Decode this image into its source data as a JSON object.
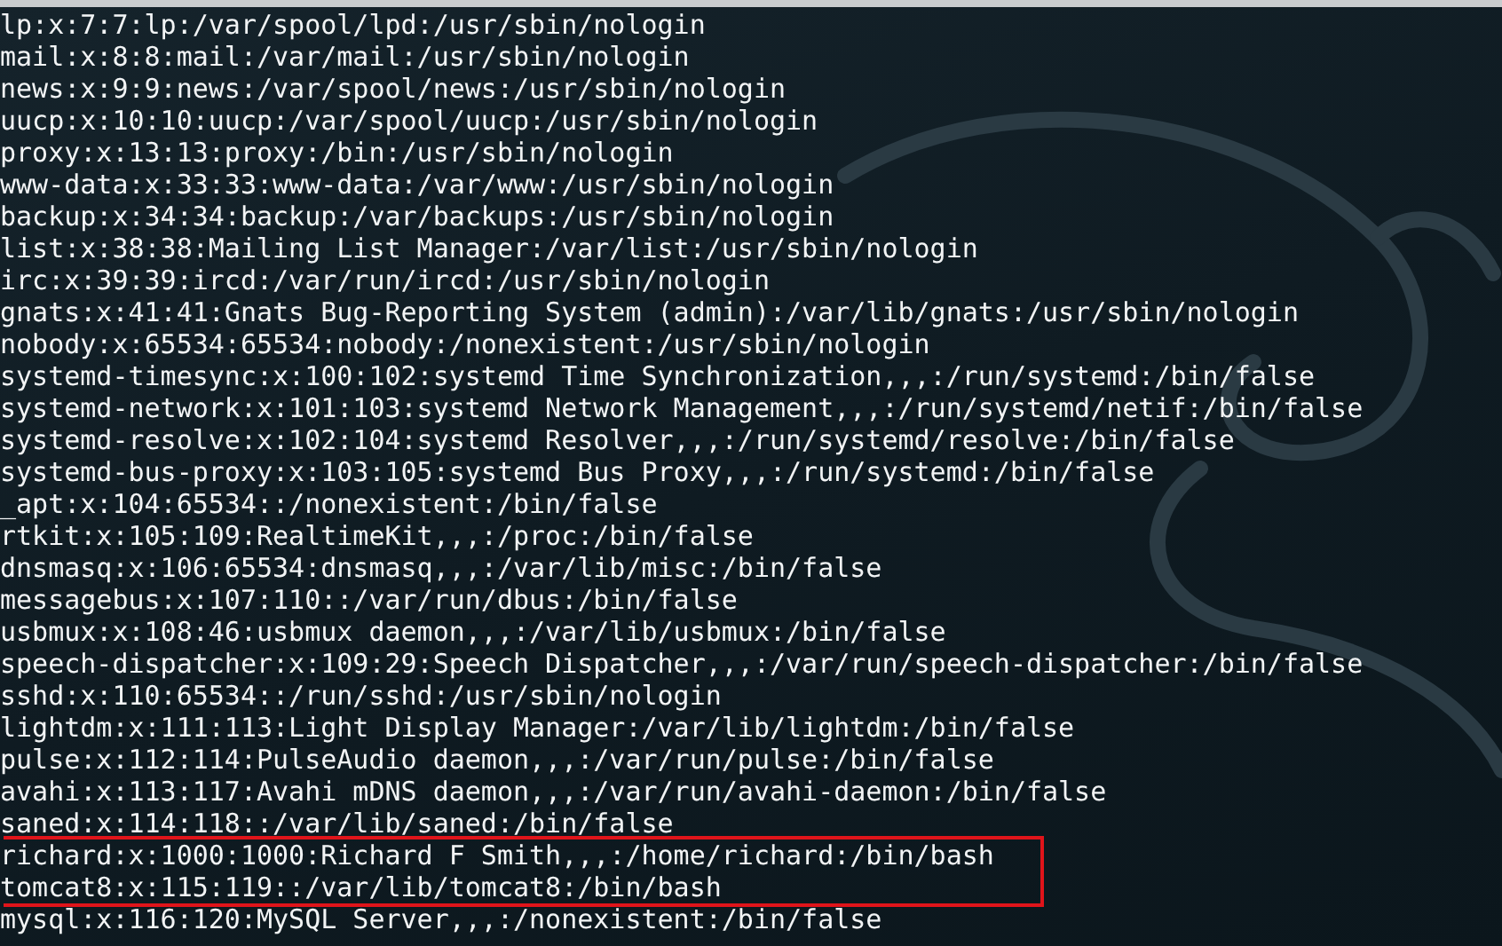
{
  "terminal": {
    "lines": [
      {
        "text": "lp:x:7:7:lp:/var/spool/lpd:/usr/sbin/nologin",
        "highlighted": false
      },
      {
        "text": "mail:x:8:8:mail:/var/mail:/usr/sbin/nologin",
        "highlighted": false
      },
      {
        "text": "news:x:9:9:news:/var/spool/news:/usr/sbin/nologin",
        "highlighted": false
      },
      {
        "text": "uucp:x:10:10:uucp:/var/spool/uucp:/usr/sbin/nologin",
        "highlighted": false
      },
      {
        "text": "proxy:x:13:13:proxy:/bin:/usr/sbin/nologin",
        "highlighted": false
      },
      {
        "text": "www-data:x:33:33:www-data:/var/www:/usr/sbin/nologin",
        "highlighted": false
      },
      {
        "text": "backup:x:34:34:backup:/var/backups:/usr/sbin/nologin",
        "highlighted": false
      },
      {
        "text": "list:x:38:38:Mailing List Manager:/var/list:/usr/sbin/nologin",
        "highlighted": false
      },
      {
        "text": "irc:x:39:39:ircd:/var/run/ircd:/usr/sbin/nologin",
        "highlighted": false
      },
      {
        "text": "gnats:x:41:41:Gnats Bug-Reporting System (admin):/var/lib/gnats:/usr/sbin/nologin",
        "highlighted": false
      },
      {
        "text": "nobody:x:65534:65534:nobody:/nonexistent:/usr/sbin/nologin",
        "highlighted": false
      },
      {
        "text": "systemd-timesync:x:100:102:systemd Time Synchronization,,,:/run/systemd:/bin/false",
        "highlighted": false
      },
      {
        "text": "systemd-network:x:101:103:systemd Network Management,,,:/run/systemd/netif:/bin/false",
        "highlighted": false
      },
      {
        "text": "systemd-resolve:x:102:104:systemd Resolver,,,:/run/systemd/resolve:/bin/false",
        "highlighted": false
      },
      {
        "text": "systemd-bus-proxy:x:103:105:systemd Bus Proxy,,,:/run/systemd:/bin/false",
        "highlighted": false
      },
      {
        "text": "_apt:x:104:65534::/nonexistent:/bin/false",
        "highlighted": false
      },
      {
        "text": "rtkit:x:105:109:RealtimeKit,,,:/proc:/bin/false",
        "highlighted": false
      },
      {
        "text": "dnsmasq:x:106:65534:dnsmasq,,,:/var/lib/misc:/bin/false",
        "highlighted": false
      },
      {
        "text": "messagebus:x:107:110::/var/run/dbus:/bin/false",
        "highlighted": false
      },
      {
        "text": "usbmux:x:108:46:usbmux daemon,,,:/var/lib/usbmux:/bin/false",
        "highlighted": false
      },
      {
        "text": "speech-dispatcher:x:109:29:Speech Dispatcher,,,:/var/run/speech-dispatcher:/bin/false",
        "highlighted": false
      },
      {
        "text": "sshd:x:110:65534::/run/sshd:/usr/sbin/nologin",
        "highlighted": false
      },
      {
        "text": "lightdm:x:111:113:Light Display Manager:/var/lib/lightdm:/bin/false",
        "highlighted": false
      },
      {
        "text": "pulse:x:112:114:PulseAudio daemon,,,:/var/run/pulse:/bin/false",
        "highlighted": false
      },
      {
        "text": "avahi:x:113:117:Avahi mDNS daemon,,,:/var/run/avahi-daemon:/bin/false",
        "highlighted": false
      },
      {
        "text": "saned:x:114:118::/var/lib/saned:/bin/false",
        "highlighted": false
      },
      {
        "text": "richard:x:1000:1000:Richard F Smith,,,:/home/richard:/bin/bash",
        "highlighted": true
      },
      {
        "text": "tomcat8:x:115:119::/var/lib/tomcat8:/bin/bash",
        "highlighted": true
      },
      {
        "text": "mysql:x:116:120:MySQL Server,,,:/nonexistent:/bin/false",
        "highlighted": false
      }
    ]
  }
}
